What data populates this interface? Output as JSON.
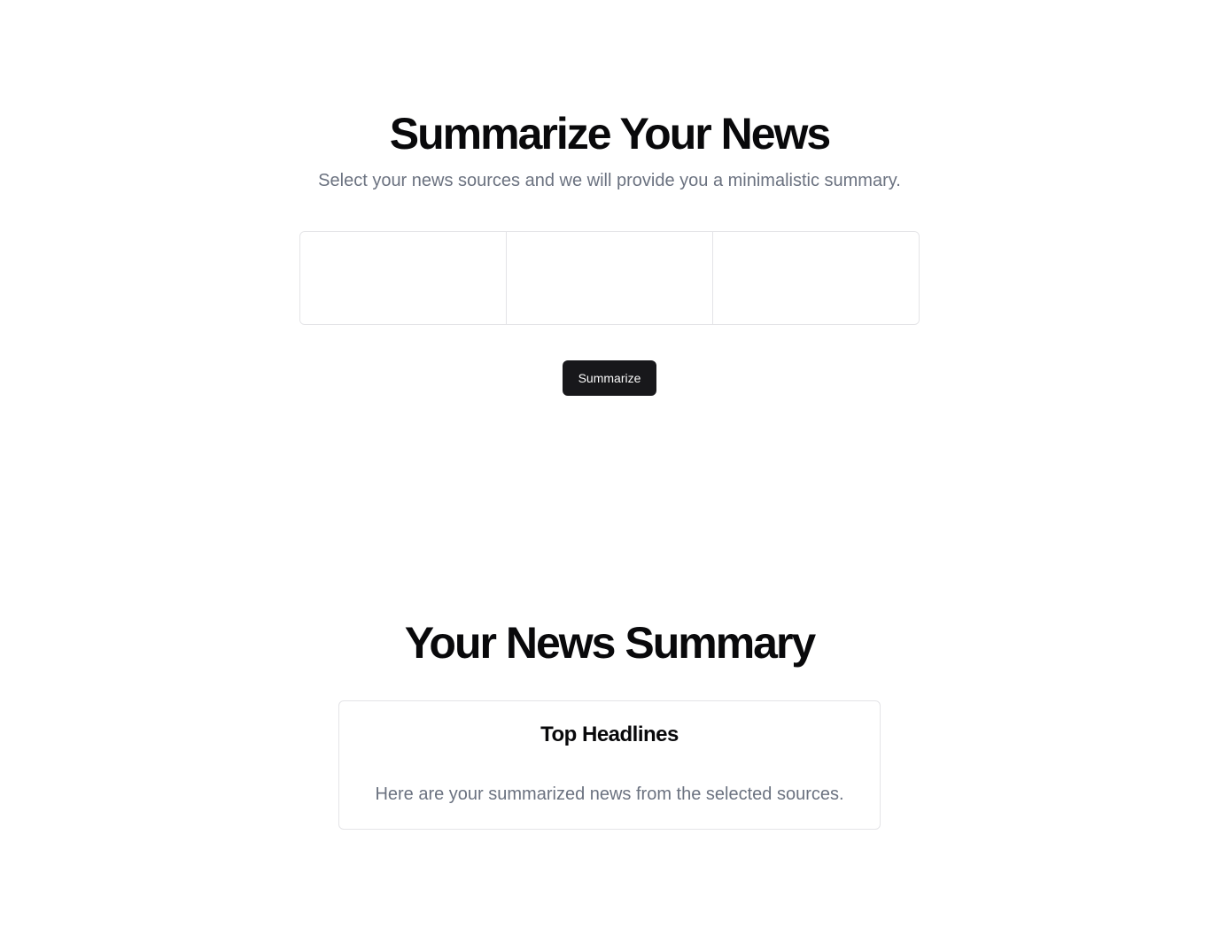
{
  "hero": {
    "title": "Summarize Your News",
    "subtitle": "Select your news sources and we will provide you a minimalistic summary."
  },
  "sources": {
    "cells": [
      "",
      "",
      ""
    ]
  },
  "actions": {
    "summarize_label": "Summarize"
  },
  "summary": {
    "title": "Your News Summary",
    "card": {
      "heading": "Top Headlines",
      "body": "Here are your summarized news from the selected sources."
    }
  },
  "colors": {
    "background": "#ffffff",
    "text": "#09090b",
    "muted_text": "#6b7280",
    "border": "#e4e4e7",
    "button_bg": "#18181b",
    "button_text": "#fafafa"
  }
}
